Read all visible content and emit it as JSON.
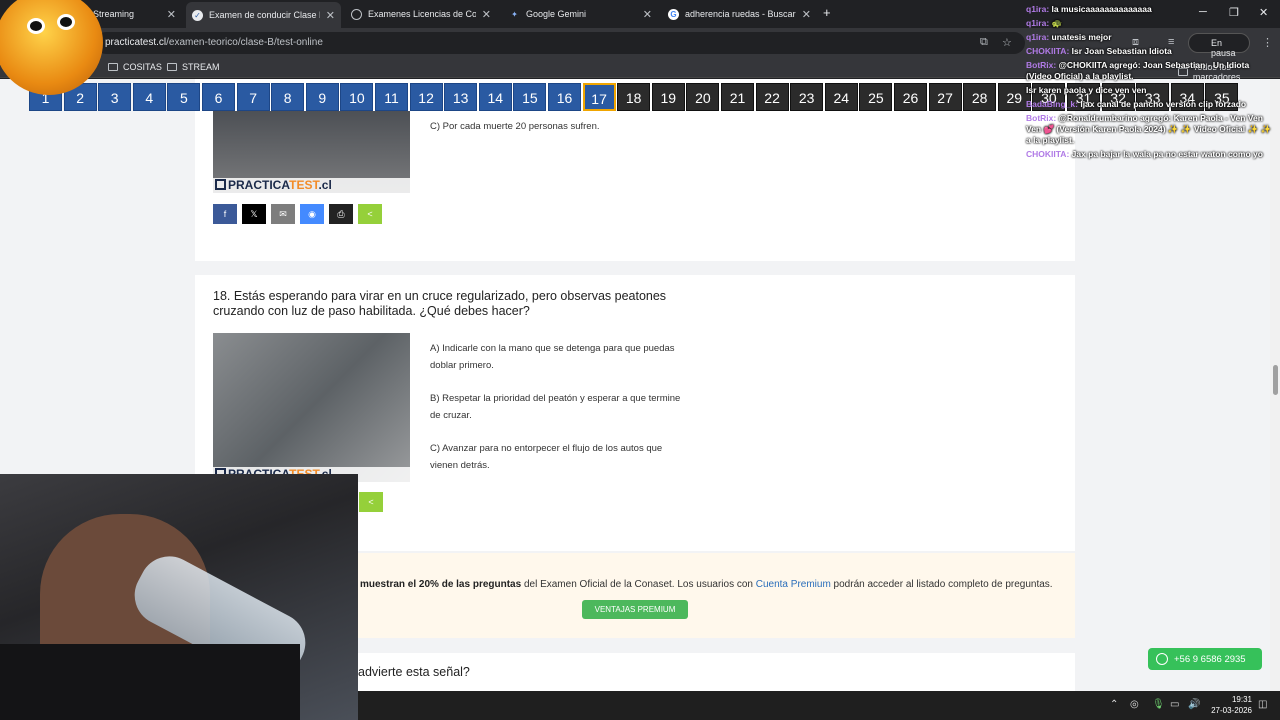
{
  "browser": {
    "tabs": [
      {
        "label": "Streaming",
        "icon": "streaming-tab-icon"
      },
      {
        "label": "Examen de conducir Clase B - C",
        "icon": "practicatest-tab-icon",
        "active": true
      },
      {
        "label": "Examenes Licencias de Conduc",
        "icon": "globe-tab-icon"
      },
      {
        "label": "Google Gemini",
        "icon": "gemini-tab-icon"
      },
      {
        "label": "adherencia ruedas - Buscar con",
        "icon": "google-tab-icon"
      }
    ],
    "url_host": "practicatest.cl",
    "url_path": "/examen-teorico/clase-B/test-online",
    "paused_label": "En pausa",
    "bookmarks": [
      "COSITAS",
      "STREAM"
    ],
    "other_bookmarks": "Todos los marcadores"
  },
  "numbers": {
    "blue": [
      "1",
      "2",
      "3",
      "4",
      "5",
      "6",
      "7",
      "8",
      "9",
      "10",
      "11",
      "12",
      "13",
      "14",
      "15",
      "16"
    ],
    "current": "17",
    "dark": [
      "18",
      "19",
      "20",
      "21",
      "22",
      "23",
      "24",
      "25",
      "26",
      "27",
      "28",
      "29",
      "30",
      "31",
      "32",
      "33",
      "34",
      "35"
    ]
  },
  "q17": {
    "option_c": "C) Por cada muerte 20 personas sufren."
  },
  "watermark": {
    "part1": "PRACTICA",
    "part2": "TEST",
    "part3": ".cl"
  },
  "q18": {
    "title": "18. Estás esperando para virar en un cruce regularizado, pero observas peatones cruzando con luz de paso habilitada. ¿Qué debes hacer?",
    "option_a": "A) Indicarle con la mano que se detenga para que puedas doblar primero.",
    "option_b": "B) Respetar la prioridad del peatón y esperar a que termine de cruzar.",
    "option_c": "C) Avanzar para no entorpecer el flujo de los autos que vienen detrás."
  },
  "share": {
    "labels": [
      "f",
      "𝕏",
      "✉",
      "◉",
      "⎙",
      "<"
    ]
  },
  "promo": {
    "bold": "muestran el 20% de las preguntas",
    "text1": " del Examen Oficial de la Conaset. Los usuarios con ",
    "link": "Cuenta Premium",
    "text2": " podrán acceder al listado completo de preguntas.",
    "button": "VENTAJAS PREMIUM"
  },
  "next_question": "advierte esta señal?",
  "whatsapp": "+56 9 6586 2935",
  "chat": [
    {
      "name": "q1ira:",
      "msg": " la musicaaaaaaaaaaaaaa"
    },
    {
      "name": "q1ira:",
      "msg": " 🐢"
    },
    {
      "name": "q1ira:",
      "msg": " unatesis mejor"
    },
    {
      "name": "CHOKIITA:",
      "msg": " Isr Joan Sebastian Idiota"
    },
    {
      "name": "BotRix:",
      "msg": " @CHOKIITA agregó: Joan Sebastian - Un Idiota (Video Oficial) a la playlist."
    },
    {
      "name": "",
      "msg": " Isr karen paola y dice ven ven"
    },
    {
      "name": "BadaBing_k:",
      "msg": " Ijax canal de pancho versión clip forzado"
    },
    {
      "name": "BotRix:",
      "msg": " @Ronaldrumbarino agregó: Karen Paola - Ven Ven Ven 💕 (Versión Karen Paola 2024) ✨ ✨ Video Oficial ✨ ✨ a la playlist."
    },
    {
      "name": "CHOKIITA:",
      "msg": " Jax pa bajar la wala pa no estar waton como yo"
    }
  ],
  "clock": {
    "time": "19:31",
    "date": "27-03-2026"
  },
  "colors": {
    "blue": "#2a5aa2",
    "current_border": "#f0a500",
    "dark": "#2b2b2b",
    "promo_button": "#4cb85c",
    "whatsapp": "#36c15a"
  }
}
